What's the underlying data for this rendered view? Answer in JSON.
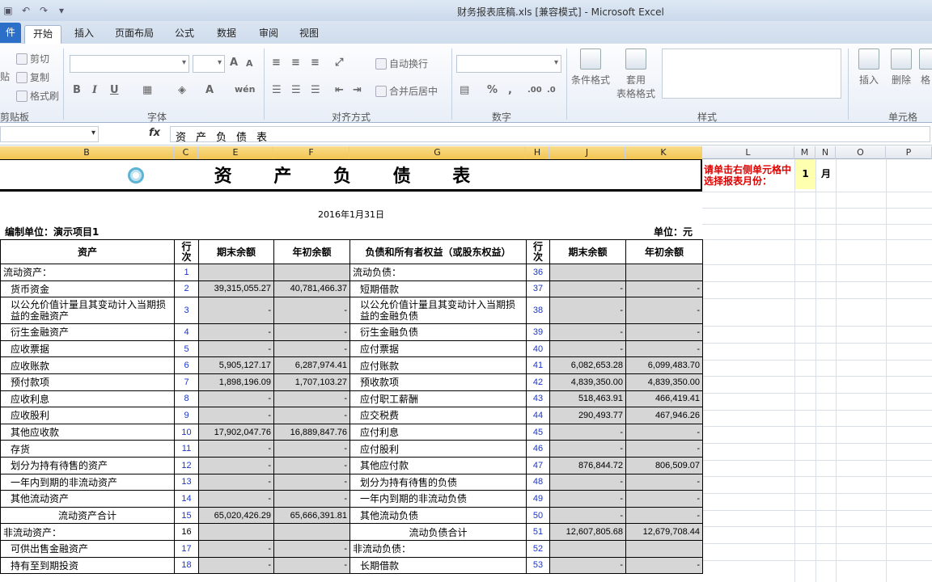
{
  "window": {
    "title": "财务报表底稿.xls  [兼容模式] - Microsoft Excel"
  },
  "ribbon": {
    "tabs": [
      "件",
      "开始",
      "插入",
      "页面布局",
      "公式",
      "数据",
      "审阅",
      "视图"
    ],
    "clipboard": {
      "cut": "剪切",
      "copy": "复制",
      "format_painter": "格式刷",
      "paste": "贴",
      "group": "剪贴板"
    },
    "font": {
      "group": "字体",
      "bold": "B",
      "italic": "I",
      "underline": "U",
      "grow": "A",
      "shrink": "A",
      "color": "A",
      "phonetic": "wén"
    },
    "alignment": {
      "group": "对齐方式",
      "wrap": "自动换行",
      "merge": "合并后居中"
    },
    "number": {
      "group": "数字",
      "percent": "%",
      "comma": ","
    },
    "styles": {
      "group": "样式",
      "conditional": "条件格式",
      "table_format_1": "套用",
      "table_format_2": "表格格式"
    },
    "cells": {
      "group": "单元格",
      "insert": "插入",
      "delete": "删除",
      "format": "格"
    }
  },
  "formula_bar": {
    "fx": "fx",
    "content": "资产负债表"
  },
  "columns": [
    "B",
    "C",
    "E",
    "F",
    "G",
    "H",
    "J",
    "K",
    "L",
    "M",
    "N",
    "O",
    "P"
  ],
  "sheet": {
    "title": "资 产 负 债 表",
    "notice": "请单击右侧单元格中选择报表月份：",
    "month_value": "1",
    "month_unit": "月",
    "date": "2016年1月31日",
    "org": "编制单位：演示项目1",
    "unit": "单位：元",
    "headers": {
      "asset": "资产",
      "line": "行次",
      "end": "期末余额",
      "begin": "年初余额",
      "liab": "负债和所有者权益（或股东权益）",
      "line2": "行次",
      "end2": "期末余额",
      "begin2": "年初余额"
    },
    "rows": [
      {
        "a": "流动资产：",
        "al": "1",
        "ae": "",
        "ab": "",
        "l": "流动负债：",
        "ll": "36",
        "le": "",
        "lb": "",
        "aind": false,
        "lind": false
      },
      {
        "a": "货币资金",
        "al": "2",
        "ae": "39,315,055.27",
        "ab": "40,781,466.37",
        "l": "短期借款",
        "ll": "37",
        "le": "-",
        "lb": "-",
        "aind": true,
        "lind": true
      },
      {
        "a": "以公允价值计量且其变动计入当期损益的金融资产",
        "al": "3",
        "ae": "-",
        "ab": "-",
        "l": "以公允价值计量且其变动计入当期损益的金融负债",
        "ll": "38",
        "le": "-",
        "lb": "-",
        "aind": true,
        "lind": true,
        "tall": true
      },
      {
        "a": "衍生金融资产",
        "al": "4",
        "ae": "-",
        "ab": "-",
        "l": "衍生金融负债",
        "ll": "39",
        "le": "-",
        "lb": "-",
        "aind": true,
        "lind": true
      },
      {
        "a": "应收票据",
        "al": "5",
        "ae": "-",
        "ab": "-",
        "l": "应付票据",
        "ll": "40",
        "le": "-",
        "lb": "-",
        "aind": true,
        "lind": true
      },
      {
        "a": "应收账款",
        "al": "6",
        "ae": "5,905,127.17",
        "ab": "6,287,974.41",
        "l": "应付账款",
        "ll": "41",
        "le": "6,082,653.28",
        "lb": "6,099,483.70",
        "aind": true,
        "lind": true
      },
      {
        "a": "预付款项",
        "al": "7",
        "ae": "1,898,196.09",
        "ab": "1,707,103.27",
        "l": "预收款项",
        "ll": "42",
        "le": "4,839,350.00",
        "lb": "4,839,350.00",
        "aind": true,
        "lind": true
      },
      {
        "a": "应收利息",
        "al": "8",
        "ae": "-",
        "ab": "-",
        "l": "应付职工薪酬",
        "ll": "43",
        "le": "518,463.91",
        "lb": "466,419.41",
        "aind": true,
        "lind": true
      },
      {
        "a": "应收股利",
        "al": "9",
        "ae": "-",
        "ab": "-",
        "l": "应交税费",
        "ll": "44",
        "le": "290,493.77",
        "lb": "467,946.26",
        "aind": true,
        "lind": true
      },
      {
        "a": "其他应收款",
        "al": "10",
        "ae": "17,902,047.76",
        "ab": "16,889,847.76",
        "l": "应付利息",
        "ll": "45",
        "le": "-",
        "lb": "-",
        "aind": true,
        "lind": true
      },
      {
        "a": "存货",
        "al": "11",
        "ae": "-",
        "ab": "-",
        "l": "应付股利",
        "ll": "46",
        "le": "-",
        "lb": "-",
        "aind": true,
        "lind": true
      },
      {
        "a": "划分为持有待售的资产",
        "al": "12",
        "ae": "-",
        "ab": "-",
        "l": "其他应付款",
        "ll": "47",
        "le": "876,844.72",
        "lb": "806,509.07",
        "aind": true,
        "lind": true
      },
      {
        "a": "一年内到期的非流动资产",
        "al": "13",
        "ae": "-",
        "ab": "-",
        "l": "划分为持有待售的负债",
        "ll": "48",
        "le": "-",
        "lb": "-",
        "aind": true,
        "lind": true
      },
      {
        "a": "其他流动资产",
        "al": "14",
        "ae": "-",
        "ab": "-",
        "l": "一年内到期的非流动负债",
        "ll": "49",
        "le": "-",
        "lb": "-",
        "aind": true,
        "lind": true
      },
      {
        "a": "流动资产合计",
        "al": "15",
        "ae": "65,020,426.29",
        "ab": "65,666,391.81",
        "l": "其他流动负债",
        "ll": "50",
        "le": "-",
        "lb": "-",
        "aind": false,
        "actr": true,
        "lind": true
      },
      {
        "a": "非流动资产：",
        "al": "16",
        "ae": "",
        "ab": "",
        "l": "流动负债合计",
        "ll": "51",
        "le": "12,607,805.68",
        "lb": "12,679,708.44",
        "aind": false,
        "lind": false,
        "lctr": true,
        "alblk": true
      },
      {
        "a": "可供出售金融资产",
        "al": "17",
        "ae": "-",
        "ab": "-",
        "l": "非流动负债：",
        "ll": "52",
        "le": "",
        "lb": "",
        "aind": true,
        "lind": false
      },
      {
        "a": "持有至到期投资",
        "al": "18",
        "ae": "-",
        "ab": "-",
        "l": "长期借款",
        "ll": "53",
        "le": "-",
        "lb": "-",
        "aind": true,
        "lind": true
      }
    ]
  }
}
